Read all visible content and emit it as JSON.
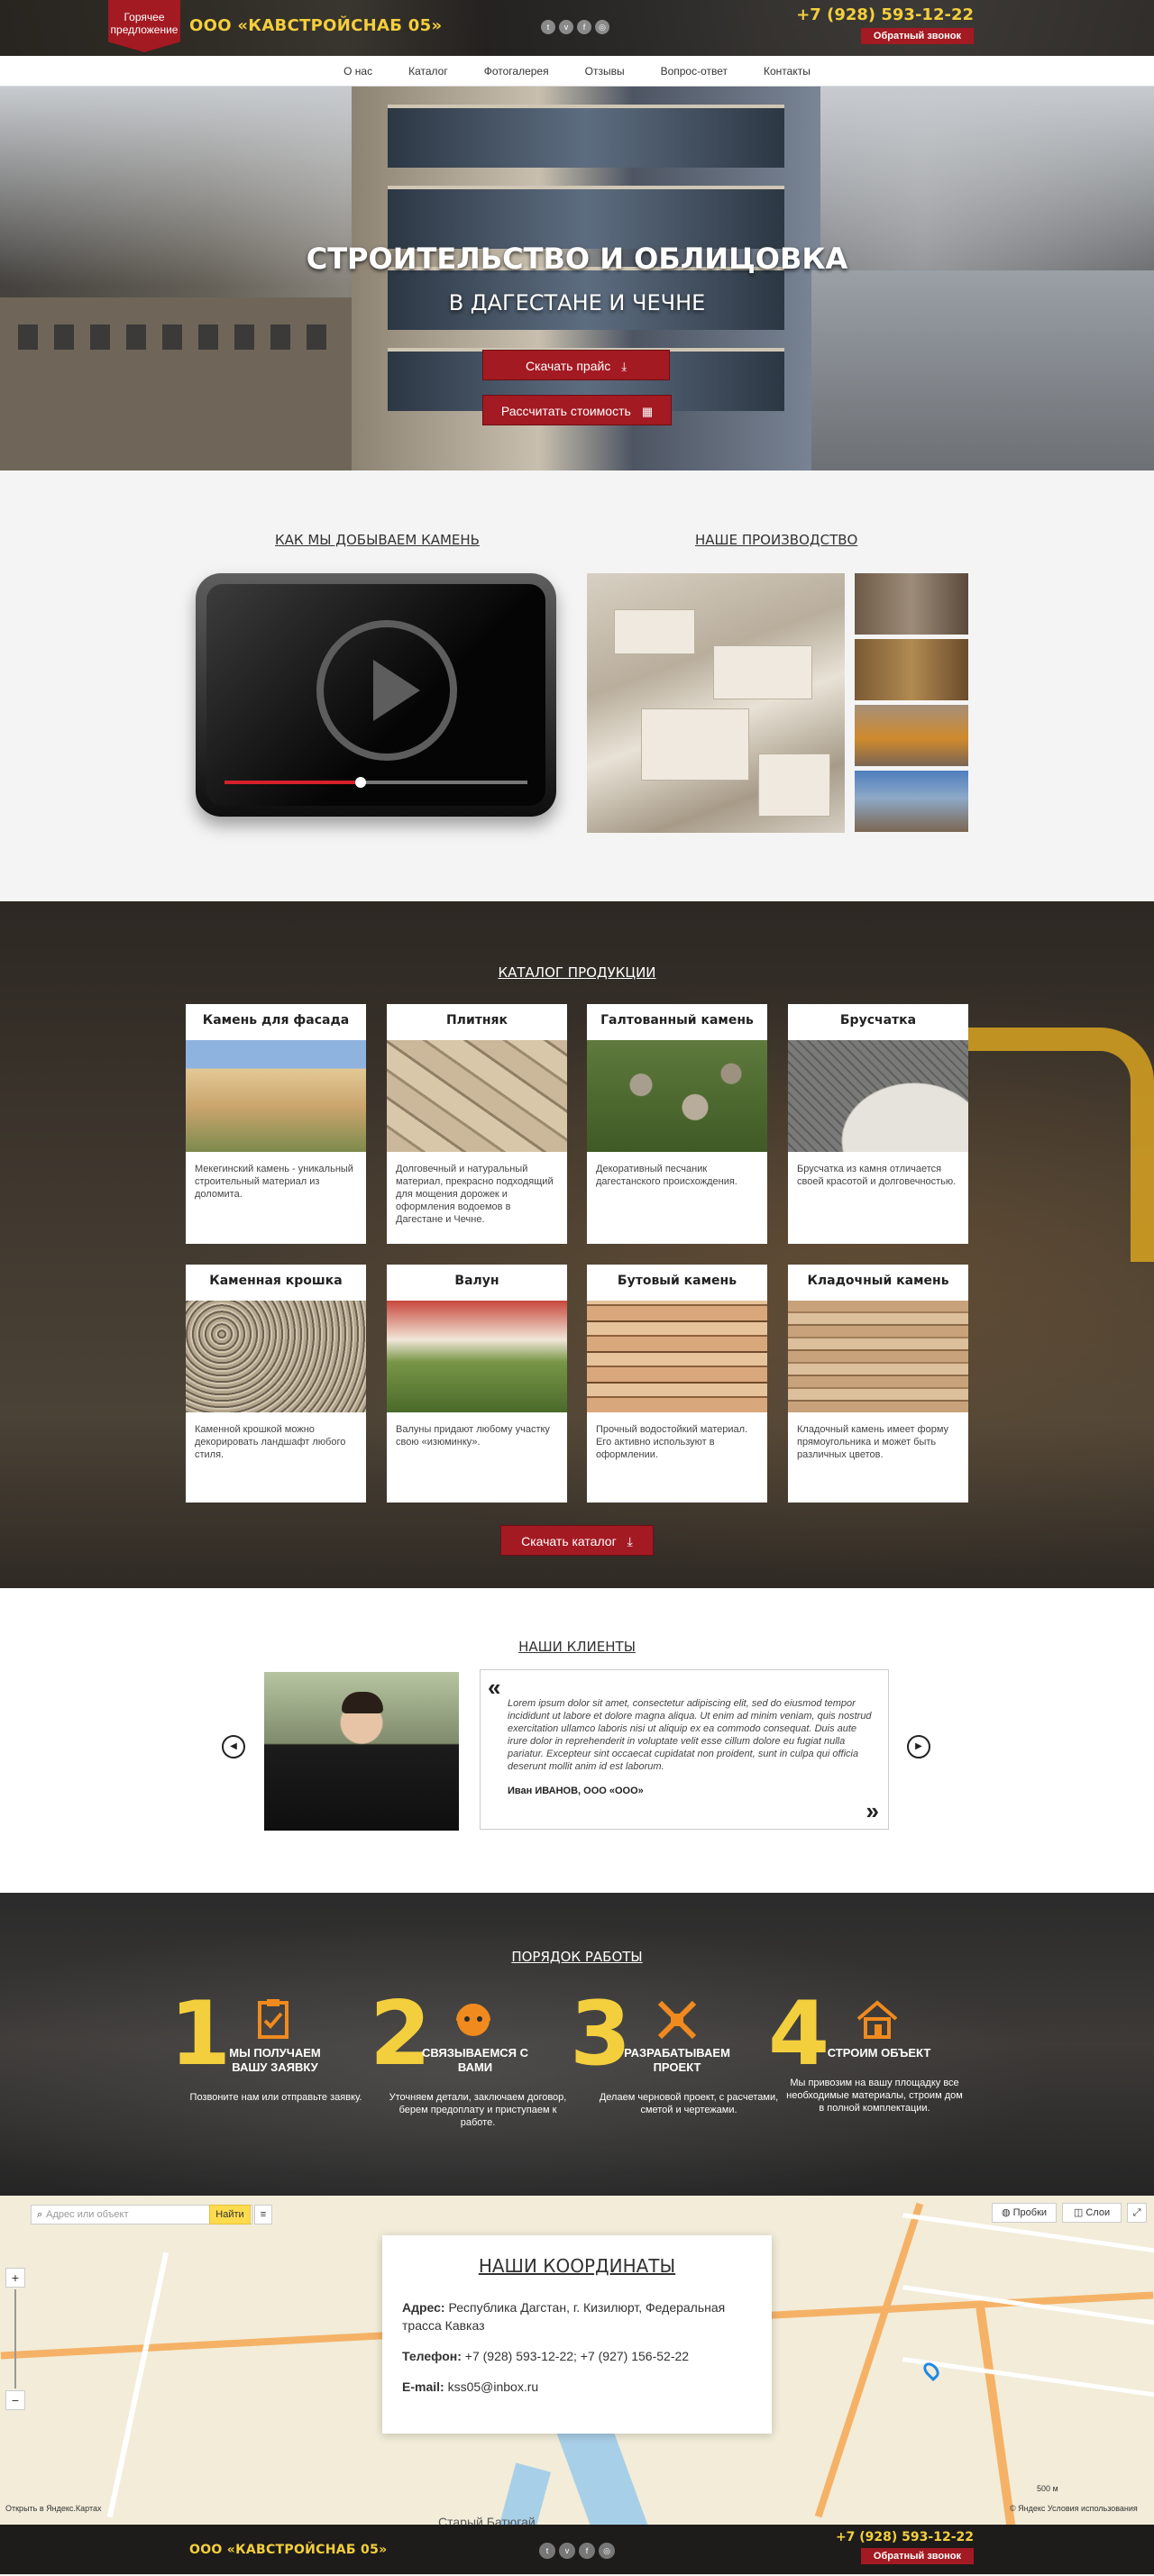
{
  "topbar": {
    "hot_offer": "Горячее предложение",
    "brand": "ООО «КАВСТРОЙСНАБ 05»",
    "phone": "+7 (928) 593-12-22",
    "callback": "Обратный звонок",
    "socials": [
      "twitter-icon",
      "vk-icon",
      "facebook-icon",
      "instagram-icon"
    ]
  },
  "nav": {
    "items": [
      "О нас",
      "Каталог",
      "Фотогалерея",
      "Отзывы",
      "Вопрос-ответ",
      "Контакты"
    ]
  },
  "hero": {
    "title": "СТРОИТЕЛЬСТВО И ОБЛИЦОВКА",
    "subtitle": "В ДАГЕСТАНЕ И ЧЕЧНЕ",
    "btn_price": "Скачать прайс",
    "btn_calc": "Рассчитать стоимость",
    "progress": 0.45
  },
  "works": {
    "video_title": "КАК МЫ ДОБЫВАЕМ КАМЕНЬ",
    "production_title": "НАШЕ ПРОИЗВОДСТВО"
  },
  "catalog": {
    "title": "КАТАЛОГ ПРОДУКЦИИ",
    "items": [
      {
        "name": "Камень для фасада",
        "desc": "Мекегинский камень - уникальный строительный материал из доломита."
      },
      {
        "name": "Плитняк",
        "desc": "Долговечный и натуральный материал, прекрасно подходящий для мощения дорожек и оформления водоемов в Дагестане и Чечне."
      },
      {
        "name": "Галтованный камень",
        "desc": "Декоративный песчаник дагестанского происхождения."
      },
      {
        "name": "Брусчатка",
        "desc": "Брусчатка из камня отличается своей красотой и долговечностью."
      },
      {
        "name": "Каменная крошка",
        "desc": "Каменной крошкой можно декорировать ландшафт любого стиля."
      },
      {
        "name": "Валун",
        "desc": "Валуны придают любому участку свою «изюминку»."
      },
      {
        "name": "Бутовый камень",
        "desc": "Прочный водостойкий материал. Его активно используют в оформлении."
      },
      {
        "name": "Кладочный камень",
        "desc": "Кладочный камень имеет форму прямоугольника и может быть различных цветов."
      }
    ],
    "download": "Скачать каталог"
  },
  "clients": {
    "title": "НАШИ КЛИЕНТЫ",
    "quote": "Lorem ipsum dolor sit amet, consectetur adipiscing elit, sed do eiusmod tempor incididunt ut labore et dolore magna aliqua. Ut enim ad minim veniam, quis nostrud exercitation ullamco laboris nisi ut aliquip ex ea commodo consequat. Duis aute irure dolor in reprehenderit in voluptate velit esse cillum dolore eu fugiat nulla pariatur. Excepteur sint occaecat cupidatat non proident, sunt in culpa qui officia deserunt mollit anim id est laborum.",
    "author": "Иван ИВАНОВ, ООО «ООО»"
  },
  "order": {
    "title": "ПОРЯДОК РАБОТЫ",
    "steps": [
      {
        "num": "1",
        "title": "МЫ ПОЛУЧАЕМ ВАШУ ЗАЯВКУ",
        "desc": "Позвоните нам или отправьте заявку.",
        "icon": "clipboard-icon"
      },
      {
        "num": "2",
        "title": "СВЯЗЫВАЕМСЯ С ВАМИ",
        "desc": "Уточняем детали, заключаем договор, берем предоплату и приступаем к работе.",
        "icon": "headset-icon"
      },
      {
        "num": "3",
        "title": "РАЗРАБАТЫВАЕМ ПРОЕКТ",
        "desc": "Делаем черновой проект, с расчетами, сметой и чертежами.",
        "icon": "tools-icon"
      },
      {
        "num": "4",
        "title": "СТРОИМ ОБЪЕКТ",
        "desc": "Мы привозим на вашу площадку все необходимые материалы, строим дом в полной комплектации.",
        "icon": "house-icon"
      }
    ]
  },
  "map": {
    "search_placeholder": "Адрес или объект",
    "find": "Найти",
    "traffic": "Пробки",
    "layers": "Слои",
    "zoom_in": "+",
    "zoom_out": "−",
    "open_in": "Открыть в Яндекс.Картах",
    "copyright": "© Яндекс Условия использования",
    "place_label": "Старый Батюгай",
    "scale": "500 м"
  },
  "contacts": {
    "title": "НАШИ КООРДИНАТЫ",
    "address_label": "Адрес:",
    "address": "Республика Дагстан, г. Кизилюрт, Федеральная трасса Кавказ",
    "phone_label": "Телефон:",
    "phones": "+7 (928) 593-12-22; +7 (927) 156-52-22",
    "email_label": "E-mail:",
    "email": "kss05@inbox.ru"
  },
  "footer": {
    "brand": "ООО «КАВСТРОЙСНАБ 05»",
    "phone": "+7 (928) 593-12-22",
    "callback": "Обратный звонок"
  },
  "colors": {
    "accent_red": "#a31a22",
    "brand_yellow": "#f4cf3d"
  }
}
